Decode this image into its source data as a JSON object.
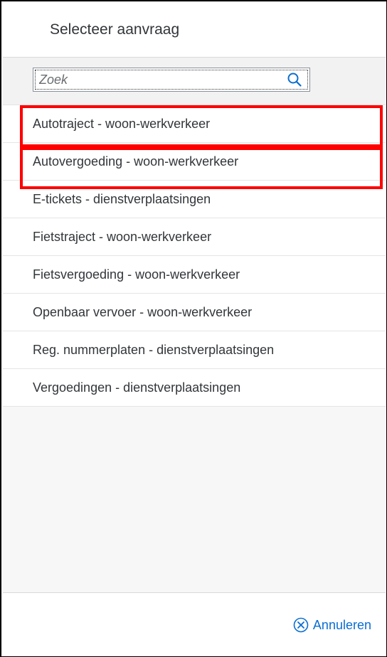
{
  "dialog": {
    "title": "Selecteer aanvraag"
  },
  "search": {
    "placeholder": "Zoek",
    "value": "",
    "icon": "search-icon"
  },
  "list": {
    "items": [
      {
        "label": "Autotraject - woon-werkverkeer",
        "highlighted": true
      },
      {
        "label": "Autovergoeding - woon-werkverkeer",
        "highlighted": true
      },
      {
        "label": "E-tickets - dienstverplaatsingen",
        "highlighted": false
      },
      {
        "label": "Fietstraject - woon-werkverkeer",
        "highlighted": false
      },
      {
        "label": "Fietsvergoeding - woon-werkverkeer",
        "highlighted": false
      },
      {
        "label": "Openbaar vervoer - woon-werkverkeer",
        "highlighted": false
      },
      {
        "label": "Reg. nummerplaten - dienstverplaatsingen",
        "highlighted": false
      },
      {
        "label": "Vergoedingen - dienstverplaatsingen",
        "highlighted": false
      }
    ]
  },
  "footer": {
    "cancel_label": "Annuleren",
    "cancel_icon": "decline-icon"
  },
  "colors": {
    "accent": "#0a6ed1",
    "highlight_border": "#ff0000",
    "text": "#32363a"
  }
}
